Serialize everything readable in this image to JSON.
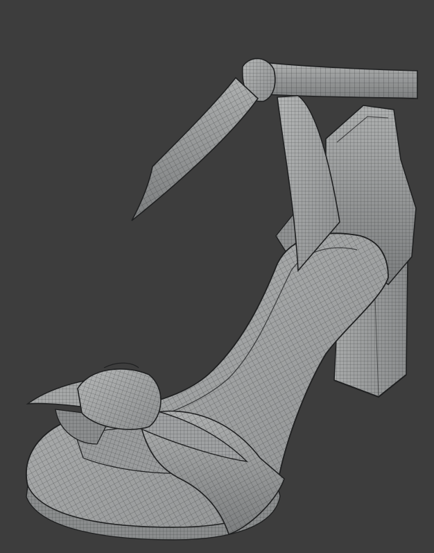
{
  "scene": {
    "subject": "wireframe-render-of-high-heel-sandal-with-ankle-tie-and-toe-bow",
    "background_color": "#3d3d3d",
    "mesh_fill_color": "#a9abab",
    "mesh_shade_color": "#7f8182",
    "wire_color": "#2a2c2d",
    "outline_color": "#1f2021"
  }
}
